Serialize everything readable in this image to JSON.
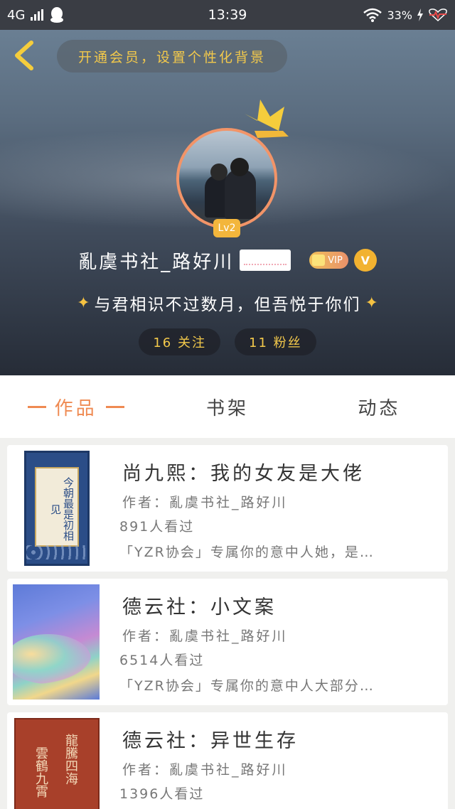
{
  "status_bar": {
    "network": "4G",
    "time": "13:39",
    "battery": "33%"
  },
  "header": {
    "vip_banner": "开通会员，设置个性化背景",
    "level": "Lv2",
    "username": "亂虞书社_路好川",
    "vip_label": "VIP",
    "v_badge": "V",
    "signature": "与君相识不过数月，但吾悦于你们",
    "following": "16 关注",
    "followers": "11 粉丝"
  },
  "tabs": [
    {
      "label": "作品",
      "active": true
    },
    {
      "label": "书架",
      "active": false
    },
    {
      "label": "动态",
      "active": false
    }
  ],
  "books": [
    {
      "title": "尚九熙：我的女友是大佬",
      "author": "作者：亂虞书社_路好川",
      "views": "891人看过",
      "desc": "「YZR协会」专属你的意中人她，是…",
      "cover_text": "今朝最是初相见"
    },
    {
      "title": "德云社：小文案",
      "author": "作者：亂虞书社_路好川",
      "views": "6514人看过",
      "desc": "「YZR协会」专属你的意中人大部分…"
    },
    {
      "title": "德云社：异世生存",
      "author": "作者：亂虞书社_路好川",
      "views": "1396人看过",
      "cover_text_a": "雲鶴九霄",
      "cover_text_b": "龍騰四海"
    }
  ],
  "colors": {
    "accent": "#ef8a52",
    "gold": "#f3c94b",
    "status_bar": "#3a3d44"
  }
}
